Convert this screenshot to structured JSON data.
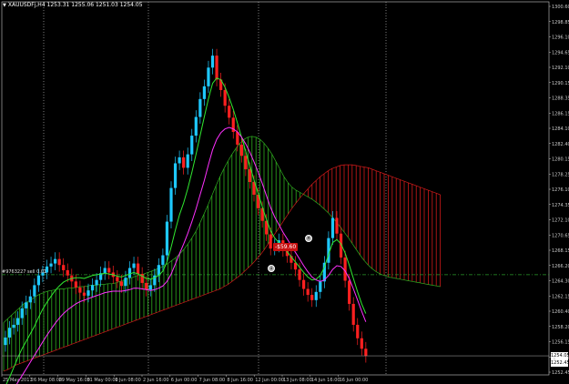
{
  "header": {
    "symbol_line": "XAUUSDFj,H4  1253.31 1255.06 1251.03 1254.05",
    "collapse_icon": "triangle-down-icon"
  },
  "price_axis": {
    "labels": [
      "1300.60",
      "1298.85",
      "1296.10",
      "1294.65",
      "1292.10",
      "1290.15",
      "1288.35",
      "1286.15",
      "1284.10",
      "1282.40",
      "1280.15",
      "1278.25",
      "1276.10",
      "1274.35",
      "1272.10",
      "1270.65",
      "1268.15",
      "1266.20",
      "1264.30",
      "1262.15",
      "1260.40",
      "1258.20",
      "1256.15",
      "1254.30",
      "1252.45"
    ]
  },
  "time_axis": {
    "labels": [
      "25 May 2017",
      "26 May 08:00",
      "29 May 16:00",
      "31 May 00:00",
      "1 Jun 08:00",
      "2 Jun 16:00",
      "6 Jun 00:00",
      "7 Jun 08:00",
      "8 Jun 16:00",
      "12 Jun 00:00",
      "13 Jun 08:00",
      "14 Jun 16:00",
      "16 Jun 00:00"
    ]
  },
  "price_boxes": {
    "current": "1254.05",
    "secondary": "1252.45"
  },
  "horizontal_line": {
    "label": "#9763227 sell 0.01"
  },
  "trade": {
    "profit_label": "-$59.60",
    "marker_open": "sell-arrow-icon",
    "marker_close": "close-icon"
  },
  "colors": {
    "background": "#000000",
    "bull_candle": "#1ec8ff",
    "bear_candle": "#ff2020",
    "cloud_bull": "#2fae1f",
    "cloud_bear": "#d01a1a",
    "fast_ma": "#30e830",
    "slow_ma": "#ff30ff",
    "hline": "#2a9a2a",
    "grid": "#d0d0d0"
  },
  "chart_data": {
    "type": "candlestick",
    "title": "XAUUSDFj,H4  1253.31 1255.06 1251.03 1254.05",
    "ylim": [
      1251.5,
      1301.4
    ],
    "x_ticks": [
      "25 May 2017",
      "26 May 08:00",
      "29 May 16:00",
      "31 May 00:00",
      "1 Jun 08:00",
      "2 Jun 16:00",
      "6 Jun 00:00",
      "7 Jun 08:00",
      "8 Jun 16:00",
      "12 Jun 00:00",
      "13 Jun 08:00",
      "14 Jun 16:00",
      "16 Jun 00:00"
    ],
    "closes": [
      1256.5,
      1257.8,
      1258.2,
      1259.1,
      1260.4,
      1261.2,
      1262.0,
      1263.5,
      1264.8,
      1265.2,
      1266.0,
      1266.4,
      1267.0,
      1266.2,
      1265.5,
      1264.8,
      1264.0,
      1263.2,
      1262.5,
      1262.1,
      1262.8,
      1263.5,
      1264.2,
      1265.1,
      1265.8,
      1265.2,
      1264.6,
      1264.0,
      1263.4,
      1264.5,
      1265.8,
      1266.4,
      1265.0,
      1263.8,
      1262.9,
      1263.5,
      1264.8,
      1266.2,
      1267.5,
      1272.0,
      1276.5,
      1279.8,
      1280.6,
      1279.2,
      1281.0,
      1283.5,
      1286.0,
      1288.4,
      1290.1,
      1292.6,
      1294.2,
      1291.0,
      1289.6,
      1287.5,
      1285.9,
      1284.0,
      1282.3,
      1280.8,
      1279.0,
      1277.3,
      1275.6,
      1273.8,
      1272.1,
      1270.3,
      1268.4,
      1268.8,
      1269.5,
      1268.2,
      1267.4,
      1266.5,
      1265.6,
      1264.2,
      1263.0,
      1262.2,
      1261.5,
      1262.6,
      1264.0,
      1266.5,
      1269.8,
      1272.5,
      1270.4,
      1267.2,
      1264.1,
      1261.0,
      1258.2,
      1256.4,
      1255.0,
      1254.05
    ],
    "fast_ma": [
      1250.0,
      1251.2,
      1252.5,
      1253.8,
      1255.0,
      1256.0,
      1257.0,
      1258.0,
      1259.2,
      1260.3,
      1261.2,
      1262.0,
      1262.8,
      1263.4,
      1263.9,
      1264.2,
      1264.4,
      1264.5,
      1264.5,
      1264.4,
      1264.6,
      1264.8,
      1264.9,
      1265.0,
      1265.1,
      1265.0,
      1264.9,
      1264.7,
      1264.6,
      1264.8,
      1265.0,
      1265.2,
      1265.0,
      1264.7,
      1264.4,
      1264.3,
      1264.5,
      1264.8,
      1265.4,
      1266.6,
      1268.6,
      1270.8,
      1272.9,
      1274.5,
      1276.4,
      1278.6,
      1281.0,
      1283.5,
      1286.0,
      1288.4,
      1290.5,
      1291.2,
      1291.0,
      1290.0,
      1288.6,
      1287.0,
      1285.2,
      1283.3,
      1281.4,
      1279.5,
      1277.6,
      1275.8,
      1274.0,
      1272.3,
      1270.8,
      1269.8,
      1269.2,
      1268.6,
      1268.0,
      1267.3,
      1266.6,
      1265.9,
      1265.2,
      1264.6,
      1264.2,
      1264.3,
      1264.8,
      1265.9,
      1267.6,
      1269.2,
      1269.6,
      1269.0,
      1267.8,
      1266.2,
      1264.4,
      1262.6,
      1261.0,
      1259.7
    ],
    "slow_ma": [
      1248.0,
      1248.8,
      1249.6,
      1250.5,
      1251.4,
      1252.3,
      1253.2,
      1254.1,
      1255.0,
      1255.9,
      1256.8,
      1257.6,
      1258.4,
      1259.1,
      1259.7,
      1260.2,
      1260.6,
      1261.0,
      1261.3,
      1261.5,
      1261.7,
      1261.9,
      1262.1,
      1262.3,
      1262.5,
      1262.6,
      1262.7,
      1262.7,
      1262.7,
      1262.8,
      1262.9,
      1263.1,
      1263.1,
      1263.0,
      1262.9,
      1262.8,
      1262.9,
      1263.1,
      1263.4,
      1264.0,
      1265.0,
      1266.3,
      1267.7,
      1269.0,
      1270.4,
      1272.0,
      1273.7,
      1275.6,
      1277.5,
      1279.6,
      1281.6,
      1283.0,
      1283.9,
      1284.4,
      1284.6,
      1284.4,
      1284.0,
      1283.3,
      1282.4,
      1281.3,
      1280.0,
      1278.6,
      1277.1,
      1275.5,
      1273.9,
      1272.6,
      1271.6,
      1270.6,
      1269.7,
      1268.8,
      1267.9,
      1267.0,
      1266.1,
      1265.3,
      1264.6,
      1264.2,
      1264.0,
      1264.2,
      1264.8,
      1265.6,
      1266.1,
      1266.0,
      1265.4,
      1264.4,
      1263.0,
      1261.5,
      1260.0,
      1258.6
    ],
    "cloud": {
      "span_a": [
        1258.5,
        1259.0,
        1259.5,
        1260.0,
        1260.5,
        1261.0,
        1261.3,
        1261.6,
        1262.0,
        1262.3,
        1262.5,
        1262.7,
        1262.8,
        1262.9,
        1263.0,
        1263.0,
        1263.1,
        1263.1,
        1263.2,
        1263.3,
        1263.3,
        1263.4,
        1263.5,
        1263.5,
        1263.6,
        1263.6,
        1263.7,
        1263.7,
        1263.8,
        1264.0,
        1264.2,
        1264.4,
        1264.5,
        1264.7,
        1264.9,
        1265.0,
        1265.2,
        1265.4,
        1265.6,
        1265.8,
        1266.1,
        1266.4,
        1266.8,
        1267.2,
        1267.7,
        1268.3,
        1269.0,
        1269.8,
        1270.7,
        1271.8,
        1273.0,
        1274.2,
        1275.5,
        1276.8,
        1278.0,
        1279.1,
        1280.1,
        1281.0,
        1281.8,
        1282.5,
        1283.0,
        1283.3,
        1283.4,
        1283.3,
        1283.0,
        1282.5,
        1281.8,
        1281.0,
        1280.0,
        1279.0,
        1278.0,
        1277.2,
        1276.6,
        1276.2,
        1275.9,
        1275.6,
        1275.3,
        1275.0,
        1274.6,
        1274.2,
        1273.7,
        1273.2,
        1272.6,
        1272.0,
        1271.3,
        1270.6,
        1269.9,
        1269.1,
        1268.3,
        1267.5,
        1266.8,
        1266.2,
        1265.7,
        1265.3,
        1265.0,
        1264.8,
        1264.6,
        1264.5,
        1264.4,
        1264.3,
        1264.2,
        1264.1,
        1264.0,
        1263.9,
        1263.8,
        1263.7,
        1263.6,
        1263.5,
        1263.4,
        1263.3
      ],
      "span_b": [
        1252.0,
        1252.2,
        1252.5,
        1252.8,
        1253.0,
        1253.2,
        1253.4,
        1253.6,
        1253.8,
        1254.0,
        1254.2,
        1254.4,
        1254.6,
        1254.8,
        1255.0,
        1255.2,
        1255.4,
        1255.6,
        1255.8,
        1256.0,
        1256.2,
        1256.4,
        1256.6,
        1256.8,
        1257.0,
        1257.2,
        1257.4,
        1257.6,
        1257.8,
        1258.0,
        1258.2,
        1258.4,
        1258.6,
        1258.8,
        1259.0,
        1259.2,
        1259.4,
        1259.6,
        1259.8,
        1260.0,
        1260.2,
        1260.4,
        1260.6,
        1260.8,
        1261.0,
        1261.2,
        1261.4,
        1261.6,
        1261.8,
        1262.0,
        1262.2,
        1262.4,
        1262.6,
        1262.8,
        1263.0,
        1263.3,
        1263.6,
        1264.0,
        1264.4,
        1264.8,
        1265.3,
        1265.8,
        1266.3,
        1266.9,
        1267.5,
        1268.2,
        1269.0,
        1269.8,
        1270.6,
        1271.4,
        1272.2,
        1273.0,
        1273.8,
        1274.5,
        1275.2,
        1275.8,
        1276.4,
        1277.0,
        1277.5,
        1278.0,
        1278.4,
        1278.8,
        1279.1,
        1279.3,
        1279.5,
        1279.6,
        1279.6,
        1279.6,
        1279.5,
        1279.4,
        1279.3,
        1279.2,
        1279.0,
        1278.8,
        1278.6,
        1278.4,
        1278.2,
        1278.0,
        1277.8,
        1277.6,
        1277.4,
        1277.2,
        1277.0,
        1276.8,
        1276.6,
        1276.4,
        1276.2,
        1276.0,
        1275.8,
        1275.6
      ]
    },
    "hline_price": 1264.9
  }
}
